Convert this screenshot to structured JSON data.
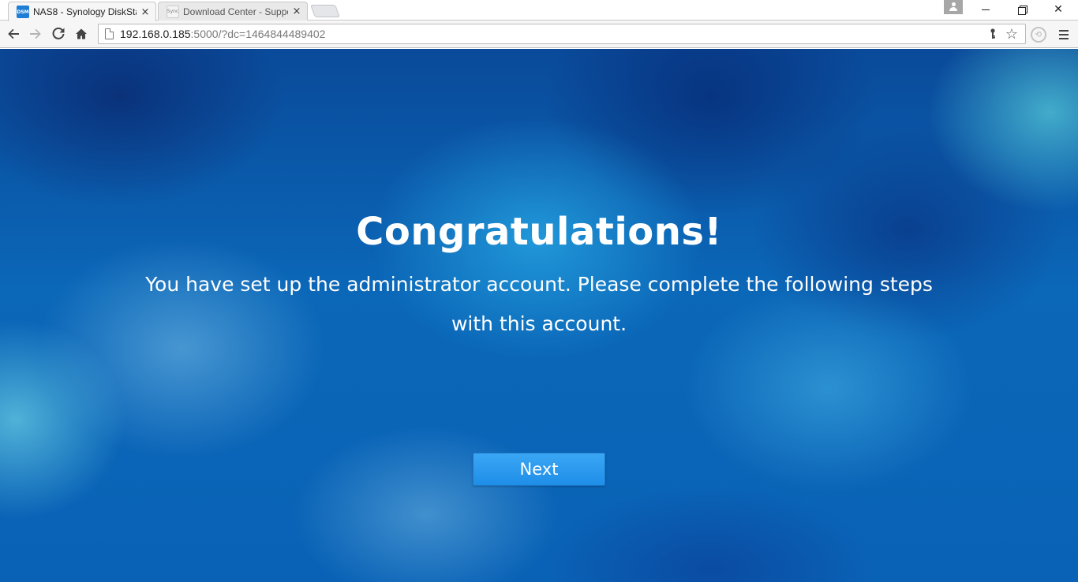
{
  "browser": {
    "tabs": [
      {
        "favicon": "DSM",
        "title": "NAS8 - Synology DiskStat",
        "close": "×"
      },
      {
        "favicon": "Sync",
        "title": "Download Center - Suppo",
        "close": "×"
      }
    ],
    "url": {
      "host": "192.168.0.185",
      "rest": ":5000/?dc=1464844489402"
    },
    "icons": {
      "back": "back-arrow-icon",
      "forward": "forward-arrow-icon",
      "reload": "reload-icon",
      "home": "home-icon",
      "page": "page-icon",
      "key": "key-icon",
      "star": "bookmark-star-icon",
      "extension": "extension-icon",
      "menu": "hamburger-menu-icon",
      "profile": "profile-icon"
    }
  },
  "page": {
    "headline": "Congratulations!",
    "message_line1": "You have set up the administrator account. Please complete the following steps",
    "message_line2": "with this account.",
    "next_label": "Next"
  },
  "colors": {
    "background": "#0b67b8",
    "button": "#2896ee",
    "text": "#ffffff"
  }
}
